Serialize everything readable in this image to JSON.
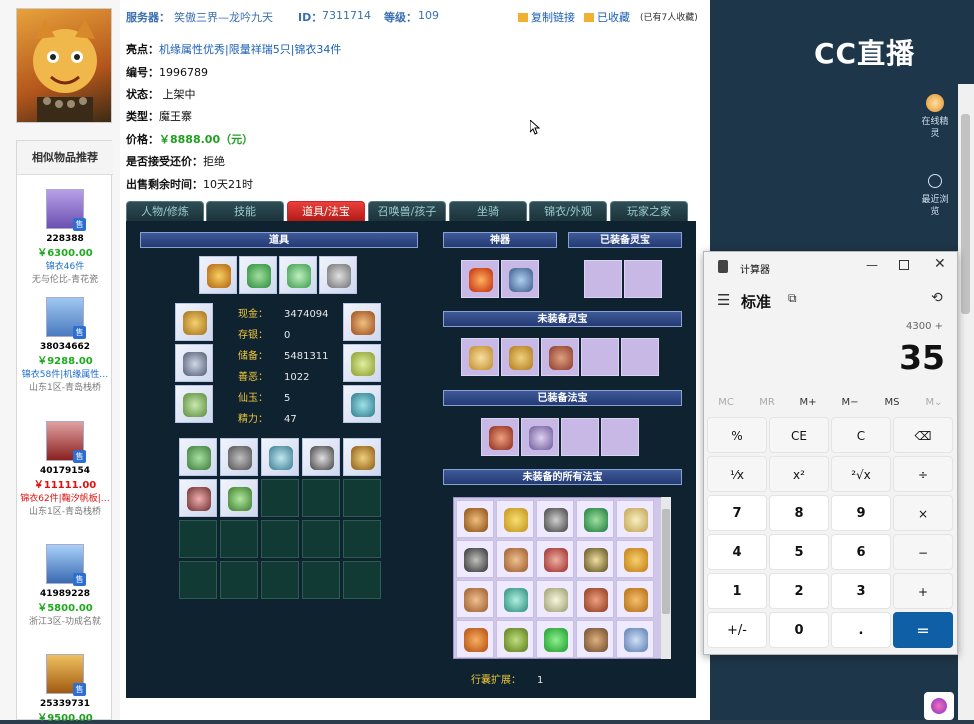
{
  "seller": {
    "server_label": "服务器：",
    "server_value": "笑傲三界—龙吟九天",
    "id_label": "ID：",
    "id_value": "7311714",
    "level_label": "等级：",
    "level_value": "109",
    "copy_link": "复制链接",
    "favorited": "已收藏",
    "favorites_count": "(已有7人收藏)"
  },
  "details": {
    "highlight_label": "亮点：",
    "highlight_value": "机缘属性优秀|限量祥瑞5只|锦衣34件",
    "number_label": "编号：",
    "number_value": "1996789",
    "status_label": "状态：",
    "status_value": "上架中",
    "type_label": "类型：",
    "type_value": "魔王寨",
    "price_label": "价格：",
    "price_value": "￥8888.00（元）",
    "bargain_label": "是否接受还价：",
    "bargain_value": "拒绝",
    "remaining_label": "出售剩余时间：",
    "remaining_value": "10天21时"
  },
  "similar": {
    "title": "相似物品推荐",
    "sale_tag": "售",
    "items": [
      {
        "id": "228388",
        "price": "￥6300.00",
        "desc": "锦衣46件",
        "server": "无与伦比-青花瓷",
        "price_red": false,
        "desc_red": false
      },
      {
        "id": "38034662",
        "price": "￥9288.00",
        "desc": "锦衣58件|机缘属性…",
        "server": "山东1区-青岛栈桥",
        "price_red": false,
        "desc_red": false
      },
      {
        "id": "40179154",
        "price": "￥11111.00",
        "desc": "锦衣62件|鞠汐帆板|…",
        "server": "山东1区-青岛栈桥",
        "price_red": true,
        "desc_red": true
      },
      {
        "id": "41989228",
        "price": "￥5800.00",
        "desc": "",
        "server": "浙江3区-功成名就",
        "price_red": false,
        "desc_red": false
      },
      {
        "id": "25339731",
        "price": "￥9500.00",
        "desc": "",
        "server": "",
        "price_red": true,
        "desc_red": false
      }
    ]
  },
  "tabs": [
    "人物/修炼",
    "技能",
    "道具/法宝",
    "召唤兽/孩子",
    "坐骑",
    "锦衣/外观",
    "玩家之家"
  ],
  "panel": {
    "props_header": "道具",
    "shenqi_header": "神器",
    "equipped_lingbao_header": "已装备灵宝",
    "unequipped_lingbao_header": "未装备灵宝",
    "equipped_fabao_header": "已装备法宝",
    "all_fabao_header": "未装备的所有法宝",
    "stats": [
      {
        "label": "现金：",
        "value": "3474094"
      },
      {
        "label": "存银：",
        "value": "0"
      },
      {
        "label": "储备：",
        "value": "5481311"
      },
      {
        "label": "善恶：",
        "value": "1022"
      },
      {
        "label": "仙玉：",
        "value": "5"
      },
      {
        "label": "精力：",
        "value": "47"
      }
    ],
    "bag_expand_label": "行囊扩展：",
    "bag_expand_value": "1"
  },
  "cc": {
    "logo": "CC直播",
    "online_elf": "在线精灵",
    "recent": "最近浏览"
  },
  "calculator": {
    "title": "计算器",
    "mode": "标准",
    "expression": "4300 +",
    "display": "35",
    "memory": [
      "MC",
      "MR",
      "M+",
      "M−",
      "MS",
      "M⌄"
    ],
    "keys": [
      [
        "%",
        "CE",
        "C",
        "⌫"
      ],
      [
        "¹⁄x",
        "x²",
        "²√x",
        "÷"
      ],
      [
        "7",
        "8",
        "9",
        "×"
      ],
      [
        "4",
        "5",
        "6",
        "−"
      ],
      [
        "1",
        "2",
        "3",
        "+"
      ],
      [
        "+/-",
        "0",
        ".",
        "="
      ]
    ]
  },
  "colors": {
    "accent_green": "#1ea01e",
    "accent_red": "#e01010",
    "tab_active": "#d12a25",
    "calc_equals": "#0f5fa6"
  }
}
